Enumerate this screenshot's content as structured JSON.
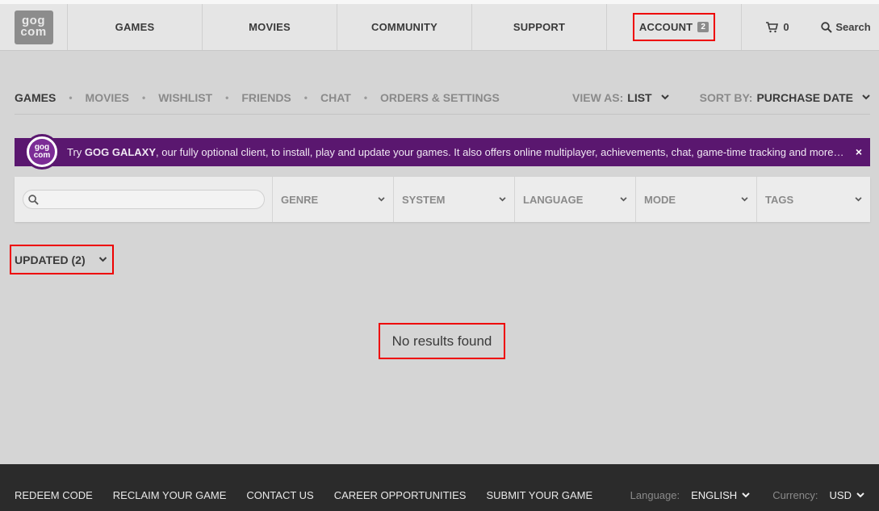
{
  "topnav": {
    "logo_lines": [
      "gog",
      "com"
    ],
    "items": [
      "GAMES",
      "MOVIES",
      "COMMUNITY",
      "SUPPORT"
    ],
    "account_label": "ACCOUNT",
    "account_badge": "2",
    "cart_count": "0",
    "search_label": "Search"
  },
  "subnav": {
    "items": [
      "GAMES",
      "MOVIES",
      "WISHLIST",
      "FRIENDS",
      "CHAT",
      "ORDERS & SETTINGS"
    ],
    "view_label": "VIEW AS:",
    "view_value": "LIST",
    "sort_label": "SORT BY:",
    "sort_value": "PURCHASE DATE"
  },
  "banner": {
    "logo_lines": [
      "gog",
      "com"
    ],
    "prefix": "Try ",
    "highlight": "GOG GALAXY",
    "text": ", our fully optional client, to install, play and update your games. It also offers online multiplayer, achievements, chat, game-time tracking and more…",
    "close": "×",
    "color": "#5a176f"
  },
  "filters": {
    "search_placeholder": "",
    "items": [
      "GENRE",
      "SYSTEM",
      "LANGUAGE",
      "MODE",
      "TAGS"
    ]
  },
  "updated": {
    "label": "UPDATED (2)"
  },
  "results": {
    "empty_text": "No results found"
  },
  "footer": {
    "links": [
      "REDEEM CODE",
      "RECLAIM YOUR GAME",
      "CONTACT US",
      "CAREER OPPORTUNITIES",
      "SUBMIT YOUR GAME"
    ],
    "language_label": "Language:",
    "language_value": "ENGLISH",
    "currency_label": "Currency:",
    "currency_value": "USD"
  },
  "colors": {
    "highlight_border": "#e00000",
    "background": "#d5d5d5",
    "footer": "#2b2b2b"
  }
}
